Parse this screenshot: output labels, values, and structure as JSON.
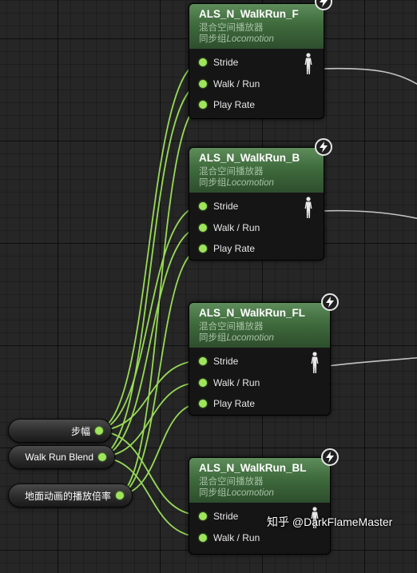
{
  "nodes": [
    {
      "title": "ALS_N_WalkRun_F",
      "subtitle": "混合空间播放器",
      "group_prefix": "同步组",
      "group_name": "Locomotion",
      "pins": [
        "Stride",
        "Walk / Run",
        "Play Rate"
      ]
    },
    {
      "title": "ALS_N_WalkRun_B",
      "subtitle": "混合空间播放器",
      "group_prefix": "同步组",
      "group_name": "Locomotion",
      "pins": [
        "Stride",
        "Walk / Run",
        "Play Rate"
      ]
    },
    {
      "title": "ALS_N_WalkRun_FL",
      "subtitle": "混合空间播放器",
      "group_prefix": "同步组",
      "group_name": "Locomotion",
      "pins": [
        "Stride",
        "Walk / Run",
        "Play Rate"
      ]
    },
    {
      "title": "ALS_N_WalkRun_BL",
      "subtitle": "混合空间播放器",
      "group_prefix": "同步组",
      "group_name": "Locomotion",
      "pins": [
        "Stride",
        "Walk / Run"
      ]
    }
  ],
  "variables": [
    {
      "label": "步幅"
    },
    {
      "label": "Walk Run Blend"
    },
    {
      "label": "地面动画的播放倍率"
    }
  ],
  "watermark": "知乎 @DarkFlameMaster",
  "colors": {
    "float_wire": "#9ee55a",
    "pose_wire": "#d8d8d8",
    "header": "#3f6b3d",
    "background": "#262626"
  },
  "icons": {
    "badge": "lightning-icon",
    "pose": "pose-figure-icon"
  }
}
